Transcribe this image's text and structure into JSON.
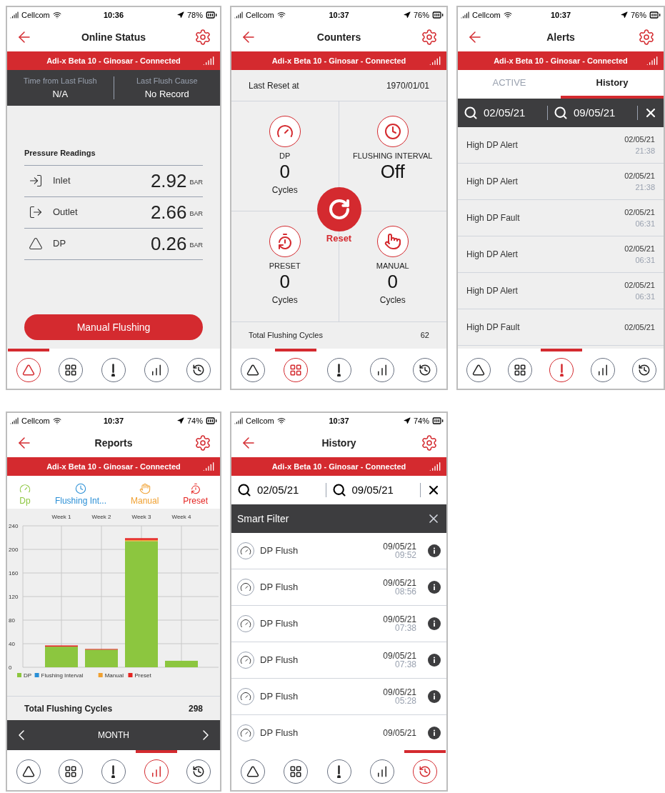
{
  "screens": [
    {
      "kind": "status",
      "status_bar": {
        "carrier": "Cellcom",
        "time": "10:36",
        "battery": "78%"
      },
      "title": "Online Status",
      "banner": "Adi-x Beta 10 - Ginosar - Connected",
      "info": [
        {
          "label": "Time from Last Flush",
          "value": "N/A"
        },
        {
          "label": "Last Flush Cause",
          "value": "No Record"
        }
      ],
      "section": "Pressure Readings",
      "readings": [
        {
          "label": "Inlet",
          "value": "2.92",
          "unit": "BAR"
        },
        {
          "label": "Outlet",
          "value": "2.66",
          "unit": "BAR"
        },
        {
          "label": "DP",
          "value": "0.26",
          "unit": "BAR"
        }
      ],
      "action": "Manual Flushing",
      "nav": [
        {
          "selected": true
        },
        {
          "selected": false
        },
        {
          "selected": false
        },
        {
          "selected": false
        },
        {
          "selected": false
        }
      ]
    },
    {
      "kind": "counters",
      "status_bar": {
        "carrier": "Cellcom",
        "time": "10:37",
        "battery": "76%"
      },
      "title": "Counters",
      "banner": "Adi-x Beta 10 - Ginosar - Connected",
      "last_reset": {
        "label": "Last Reset at",
        "value": "1970/01/01"
      },
      "counters": [
        {
          "label": "DP",
          "value": "0",
          "unit": "Cycles"
        },
        {
          "label": "FLUSHING INTERVAL",
          "value": "Off"
        },
        {
          "label": "PRESET",
          "value": "0",
          "unit": "Cycles"
        },
        {
          "label": "MANUAL",
          "value": "0",
          "unit": "Cycles"
        }
      ],
      "reset": "Reset",
      "total": {
        "label": "Total Flushing Cycles",
        "value": "62"
      },
      "nav": [
        {
          "selected": false
        },
        {
          "selected": true
        },
        {
          "selected": false
        },
        {
          "selected": false
        },
        {
          "selected": false
        }
      ]
    },
    {
      "kind": "alerts",
      "status_bar": {
        "carrier": "Cellcom",
        "time": "10:37",
        "battery": "76%"
      },
      "title": "Alerts",
      "banner": "Adi-x Beta 10 - Ginosar - Connected",
      "tabs": [
        {
          "label": "ACTIVE",
          "selected": false
        },
        {
          "label": "History",
          "selected": true
        }
      ],
      "search": {
        "from": "02/05/21",
        "to": "09/05/21"
      },
      "rows": [
        {
          "title": "High DP Alert",
          "date": "02/05/21",
          "time": "21:38"
        },
        {
          "title": "High DP Alert",
          "date": "02/05/21",
          "time": "21:38"
        },
        {
          "title": "High DP Fault",
          "date": "02/05/21",
          "time": "06:31"
        },
        {
          "title": "High DP Alert",
          "date": "02/05/21",
          "time": "06:31"
        },
        {
          "title": "High DP Alert",
          "date": "02/05/21",
          "time": "06:31"
        },
        {
          "title": "High DP Fault",
          "date": "02/05/21"
        }
      ],
      "nav": [
        {
          "selected": false
        },
        {
          "selected": false
        },
        {
          "selected": true
        },
        {
          "selected": false
        },
        {
          "selected": false
        }
      ]
    },
    {
      "kind": "reports",
      "status_bar": {
        "carrier": "Cellcom",
        "time": "10:37",
        "battery": "74%"
      },
      "title": "Reports",
      "banner": "Adi-x Beta 10 - Ginosar - Connected",
      "legend": [
        {
          "label": "Dp",
          "color": "#8cc63f"
        },
        {
          "label": "Flushing Int...",
          "color": "#2a8fd6"
        },
        {
          "label": "Manual",
          "color": "#f0a030"
        },
        {
          "label": "Preset",
          "color": "#e52421"
        }
      ],
      "chart_data": {
        "type": "bar",
        "stacked": true,
        "categories": [
          "Week 1",
          "Week 2",
          "Week 3",
          "Week 4"
        ],
        "series": [
          {
            "name": "DP",
            "color": "#8cc63f",
            "values": [
              35,
              30,
              214,
              11
            ]
          },
          {
            "name": "Flushing Interval",
            "color": "#2a8fd6",
            "values": [
              0,
              0,
              0,
              0
            ]
          },
          {
            "name": "Manual",
            "color": "#f0a030",
            "values": [
              0,
              0,
              2,
              0
            ]
          },
          {
            "name": "Preset",
            "color": "#e52421",
            "values": [
              2,
              1,
              3,
              0
            ]
          }
        ],
        "grid": true,
        "legend": true,
        "ylim": [
          0,
          240
        ],
        "yticks": [
          0,
          40,
          80,
          120,
          160,
          200,
          240
        ]
      },
      "total": {
        "label": "Total Flushing Cycles",
        "value": "298"
      },
      "period": "MONTH",
      "nav": [
        {
          "selected": false
        },
        {
          "selected": false
        },
        {
          "selected": false
        },
        {
          "selected": true
        },
        {
          "selected": false
        }
      ]
    },
    {
      "kind": "history",
      "status_bar": {
        "carrier": "Cellcom",
        "time": "10:37",
        "battery": "74%"
      },
      "title": "History",
      "banner": "Adi-x Beta 10 - Ginosar - Connected",
      "search": {
        "from": "02/05/21",
        "to": "09/05/21"
      },
      "filter": "Smart Filter",
      "rows": [
        {
          "title": "DP Flush",
          "date": "09/05/21",
          "time": "09:52"
        },
        {
          "title": "DP Flush",
          "date": "09/05/21",
          "time": "08:56"
        },
        {
          "title": "DP Flush",
          "date": "09/05/21",
          "time": "07:38"
        },
        {
          "title": "DP Flush",
          "date": "09/05/21",
          "time": "07:38"
        },
        {
          "title": "DP Flush",
          "date": "09/05/21",
          "time": "05:28"
        },
        {
          "title": "DP Flush",
          "date": "09/05/21"
        }
      ],
      "nav": [
        {
          "selected": false
        },
        {
          "selected": false
        },
        {
          "selected": false
        },
        {
          "selected": false
        },
        {
          "selected": true
        }
      ]
    }
  ]
}
